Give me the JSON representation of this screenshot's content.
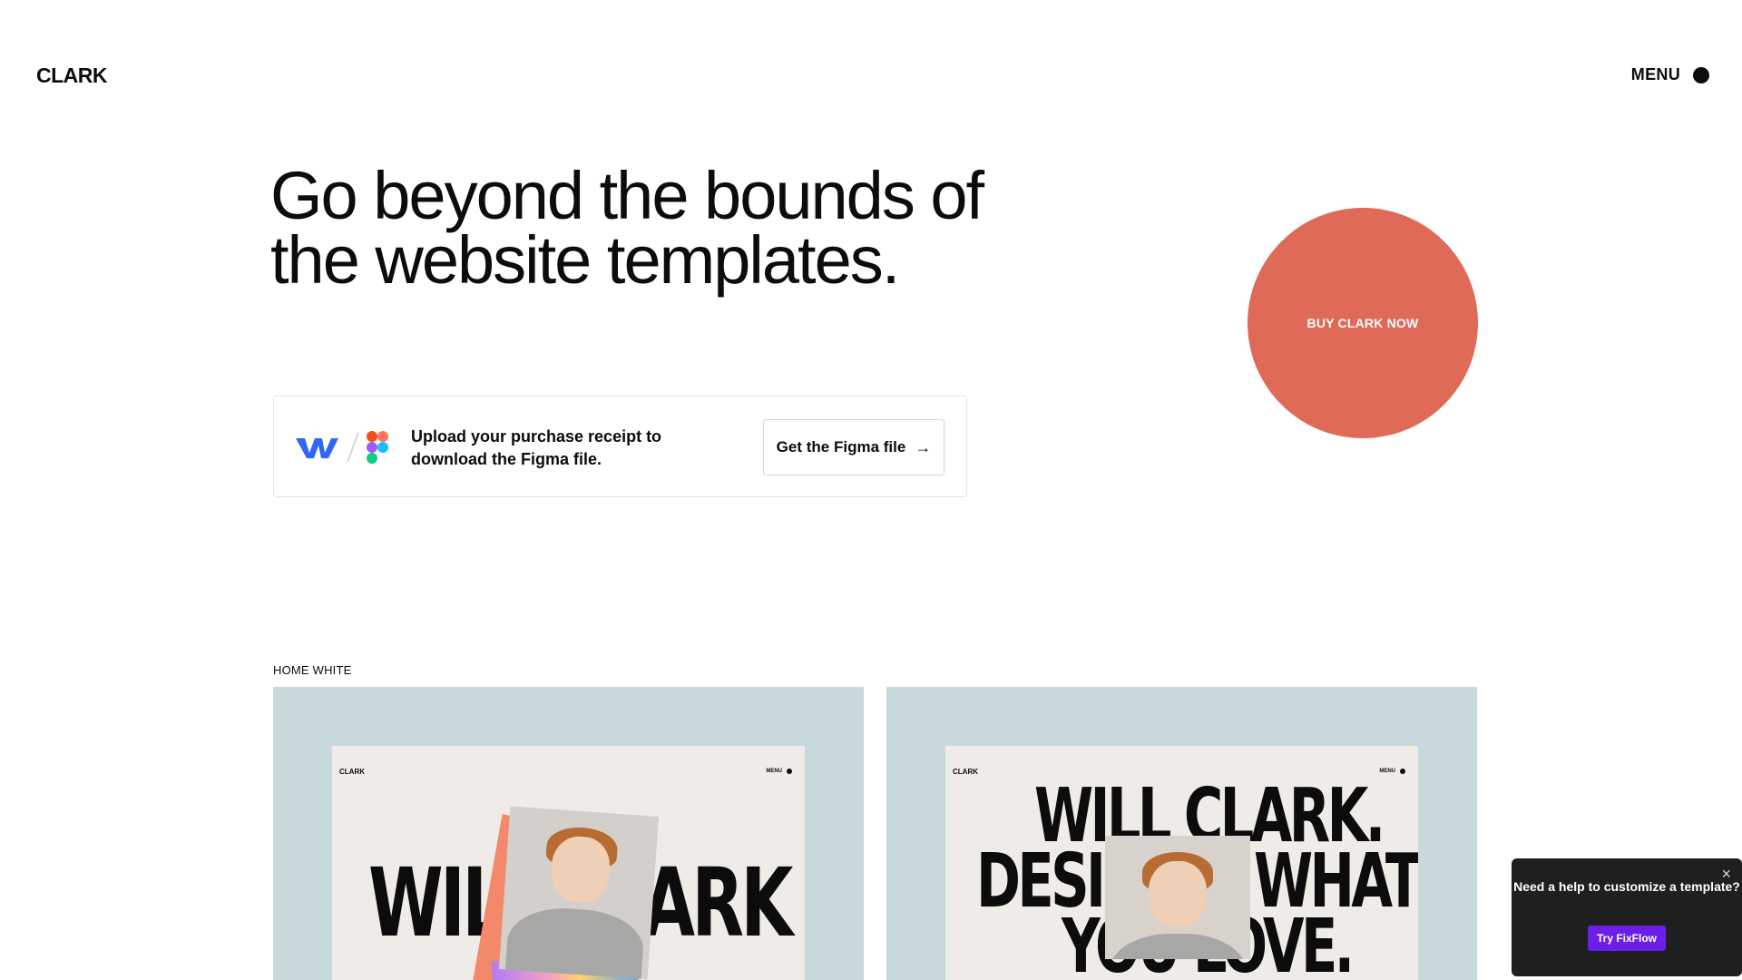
{
  "header": {
    "logo": "CLARK",
    "menu_label": "MENU"
  },
  "hero": {
    "title": "Go beyond the bounds of the website templates."
  },
  "figma_card": {
    "text": "Upload your purchase receipt to download the Figma file.",
    "button_label": "Get the Figma file",
    "icons": [
      "webflow-icon",
      "figma-icon",
      "arrow-right-icon"
    ]
  },
  "buy_button": {
    "label": "BUY CLARK NOW",
    "color": "#df6a57"
  },
  "section": {
    "label": "HOME WHITE"
  },
  "previews": [
    {
      "logo": "CLARK",
      "menu": "MENU",
      "headline_left": "WIL",
      "headline_right": "ARK"
    },
    {
      "logo": "CLARK",
      "menu": "MENU",
      "line1": "WILL CLARK.",
      "line2_left": "DESIG",
      "line2_right": "WHAT",
      "line3": "YOU LOVE."
    }
  ],
  "help_popup": {
    "text": "Need a help to customize a template?",
    "button_label": "Try FixFlow",
    "accent": "#6a1ee8"
  },
  "colors": {
    "background": "#ffffff",
    "text": "#0c0c0c",
    "preview_bg": "#c8d9dd",
    "preview_inner": "#efebe7"
  }
}
